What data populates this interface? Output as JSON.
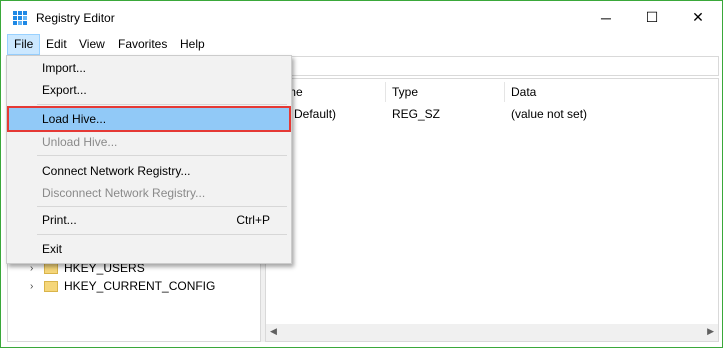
{
  "window": {
    "title": "Registry Editor",
    "controls": {
      "minimize": "─",
      "maximize": "☐",
      "close": "✕"
    }
  },
  "menubar": [
    "File",
    "Edit",
    "View",
    "Favorites",
    "Help"
  ],
  "file_menu": {
    "import": "Import...",
    "export": "Export...",
    "load_hive": "Load Hive...",
    "unload_hive": "Unload Hive...",
    "connect": "Connect Network Registry...",
    "disconnect": "Disconnect Network Registry...",
    "print": "Print...",
    "print_shortcut": "Ctrl+P",
    "exit": "Exit"
  },
  "tree": {
    "users": "HKEY_USERS",
    "current_config": "HKEY_CURRENT_CONFIG"
  },
  "list": {
    "headers": {
      "name": "me",
      "type": "Type",
      "data": "Data"
    },
    "rows": [
      {
        "name": "Default)",
        "type": "REG_SZ",
        "data": "(value not set)"
      }
    ]
  },
  "scroll": {
    "left": "◀",
    "right": "▶"
  },
  "chev": "›",
  "colors": {
    "highlight": "#91c9f7",
    "outline": "#e53935",
    "window_border": "#3aa83a"
  }
}
